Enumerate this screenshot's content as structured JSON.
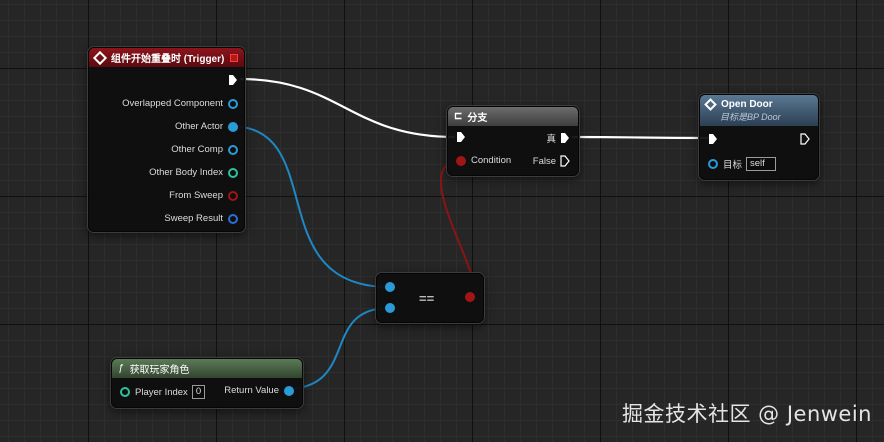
{
  "overlap_node": {
    "title": "组件开始重叠时 (Trigger)",
    "header_color": "#7a1018",
    "pins": [
      {
        "label": "Overlapped Component",
        "color": "#2a9bd6"
      },
      {
        "label": "Other Actor",
        "color": "#2a9bd6"
      },
      {
        "label": "Other Comp",
        "color": "#2a9bd6"
      },
      {
        "label": "Other Body Index",
        "color": "#2fc29a"
      },
      {
        "label": "From Sweep",
        "color": "#a21515"
      },
      {
        "label": "Sweep Result",
        "color": "#2a6fd6"
      }
    ]
  },
  "branch_node": {
    "title": "分支",
    "condition_label": "Condition",
    "true_label": "真",
    "false_label": "False"
  },
  "open_door_node": {
    "title": "Open Door",
    "subtitle": "目标是BP Door",
    "target_label": "目标",
    "target_value": "self"
  },
  "equal_node": {
    "symbol": "=="
  },
  "get_player_node": {
    "title": "获取玩家角色",
    "player_index_label": "Player Index",
    "player_index_value": "0",
    "return_label": "Return Value"
  },
  "watermark": "掘金技术社区 @ Jenwein",
  "colors": {
    "exec": "#ffffff",
    "object": "#2a9bd6",
    "bool": "#a21515",
    "int": "#2fc29a"
  }
}
